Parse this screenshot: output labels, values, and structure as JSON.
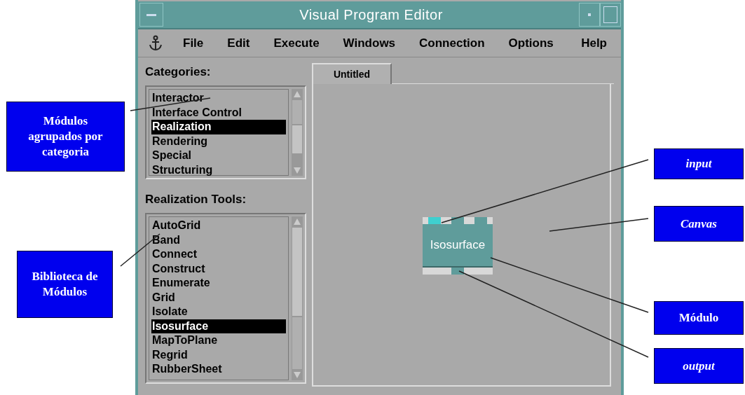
{
  "window": {
    "title": "Visual Program Editor"
  },
  "menu": [
    {
      "label": "File"
    },
    {
      "label": "Edit"
    },
    {
      "label": "Execute"
    },
    {
      "label": "Windows"
    },
    {
      "label": "Connection"
    },
    {
      "label": "Options"
    },
    {
      "label": "Help"
    }
  ],
  "categories": {
    "label": "Categories:",
    "items": [
      {
        "label": "Interactor",
        "selected": false
      },
      {
        "label": "Interface Control",
        "selected": false
      },
      {
        "label": "Realization",
        "selected": true
      },
      {
        "label": "Rendering",
        "selected": false
      },
      {
        "label": "Special",
        "selected": false
      },
      {
        "label": "Structuring",
        "selected": false
      }
    ]
  },
  "tools": {
    "label": "Realization Tools:",
    "items": [
      {
        "label": "AutoGrid",
        "selected": false
      },
      {
        "label": "Band",
        "selected": false
      },
      {
        "label": "Connect",
        "selected": false
      },
      {
        "label": "Construct",
        "selected": false
      },
      {
        "label": "Enumerate",
        "selected": false
      },
      {
        "label": "Grid",
        "selected": false
      },
      {
        "label": "Isolate",
        "selected": false
      },
      {
        "label": "Isosurface",
        "selected": true
      },
      {
        "label": "MapToPlane",
        "selected": false
      },
      {
        "label": "Regrid",
        "selected": false
      },
      {
        "label": "RubberSheet",
        "selected": false
      }
    ]
  },
  "tabs": [
    {
      "label": "Untitled",
      "selected": true
    }
  ],
  "module": {
    "label": "Isosurface",
    "inputs": [
      {
        "highlighted": true
      },
      {
        "highlighted": false
      },
      {
        "highlighted": false
      }
    ],
    "outputs": [
      {
        "highlighted": false
      }
    ]
  },
  "annotations": [
    {
      "text": "Módulos agrupados por categoria",
      "italic": false
    },
    {
      "text": "Biblioteca de Módulos",
      "italic": false
    },
    {
      "text": "input",
      "italic": true
    },
    {
      "text": "Canvas",
      "italic": true
    },
    {
      "text": "Módulo",
      "italic": false
    },
    {
      "text": "output",
      "italic": true
    }
  ]
}
